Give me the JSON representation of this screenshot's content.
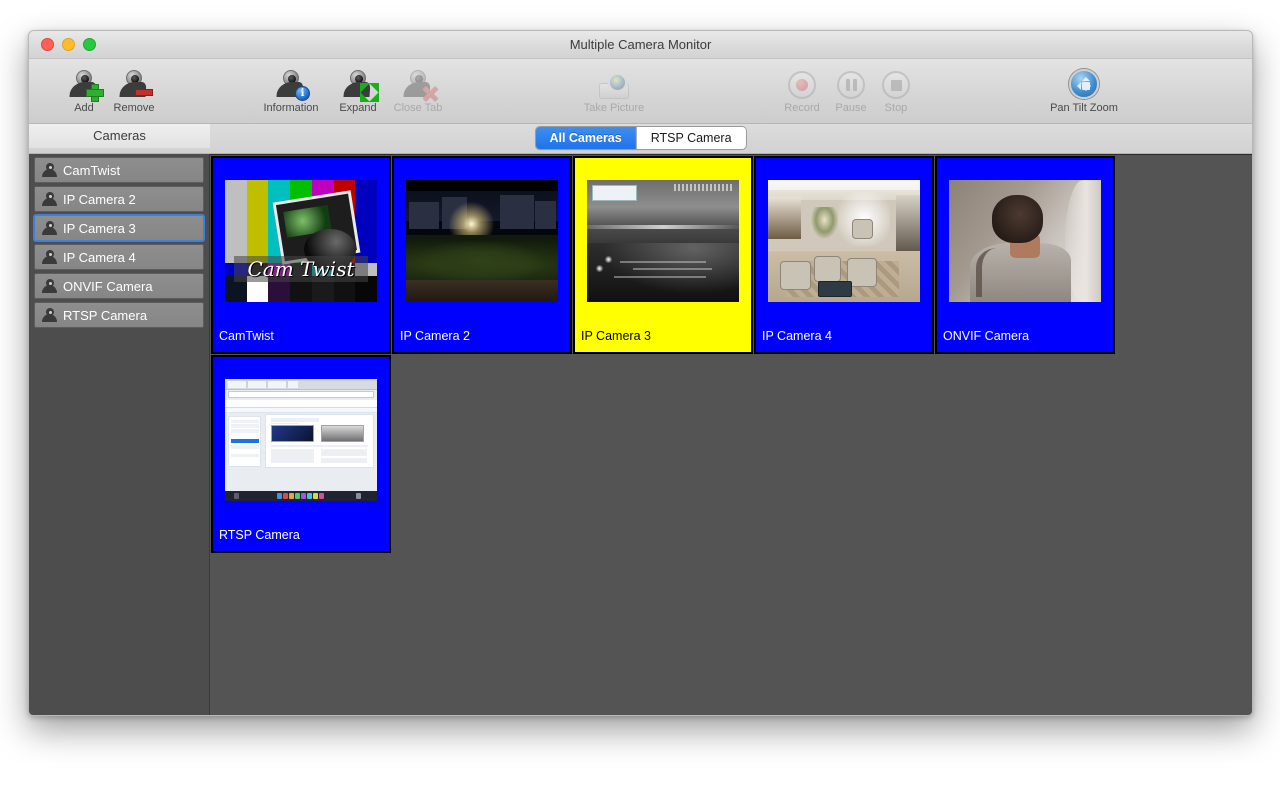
{
  "window": {
    "title": "Multiple Camera Monitor",
    "traffic_lights": [
      "close",
      "minimize",
      "maximize"
    ]
  },
  "toolbar": {
    "items": [
      {
        "label": "Add",
        "icon": "webcam-plus-icon",
        "disabled": false
      },
      {
        "label": "Remove",
        "icon": "webcam-minus-icon",
        "disabled": false
      },
      {
        "label": "Information",
        "icon": "webcam-info-icon",
        "disabled": false
      },
      {
        "label": "Expand",
        "icon": "webcam-expand-icon",
        "disabled": false
      },
      {
        "label": "Close Tab",
        "icon": "webcam-close-icon",
        "disabled": true
      },
      {
        "label": "Take Picture",
        "icon": "camera-icon",
        "disabled": true
      },
      {
        "label": "Record",
        "icon": "record-icon",
        "disabled": true
      },
      {
        "label": "Pause",
        "icon": "pause-icon",
        "disabled": true
      },
      {
        "label": "Stop",
        "icon": "stop-icon",
        "disabled": true
      },
      {
        "label": "Pan Tilt Zoom",
        "icon": "pan-tilt-zoom-icon",
        "disabled": false
      }
    ]
  },
  "tabs": {
    "items": [
      {
        "label": "All Cameras",
        "active": true
      },
      {
        "label": "RTSP Camera",
        "active": false
      }
    ]
  },
  "sidebar": {
    "header": "Cameras",
    "items": [
      {
        "label": "CamTwist",
        "selected": false
      },
      {
        "label": "IP Camera 2",
        "selected": false
      },
      {
        "label": "IP Camera 3",
        "selected": true
      },
      {
        "label": "IP Camera 4",
        "selected": false
      },
      {
        "label": "ONVIF Camera",
        "selected": false
      },
      {
        "label": "RTSP Camera",
        "selected": false
      }
    ]
  },
  "grid": {
    "tiles": [
      {
        "caption": "CamTwist",
        "scene": "camtwist",
        "highlight": false
      },
      {
        "caption": "IP Camera 2",
        "scene": "plaza",
        "highlight": false
      },
      {
        "caption": "IP Camera 3",
        "scene": "beach",
        "highlight": true
      },
      {
        "caption": "IP Camera 4",
        "scene": "lobby",
        "highlight": false
      },
      {
        "caption": "ONVIF Camera",
        "scene": "person",
        "highlight": false
      },
      {
        "caption": "RTSP Camera",
        "scene": "browser",
        "highlight": false
      }
    ]
  },
  "camtwist": {
    "wordmark": "Cam Twist"
  },
  "colors": {
    "tile_normal": "#0000ff",
    "tile_highlight": "#ffff00",
    "tab_active": "#1f73e8",
    "stage_background": "#545454",
    "sidebar_background": "#4d4d4d",
    "selection_ring": "#3b7fe0"
  }
}
